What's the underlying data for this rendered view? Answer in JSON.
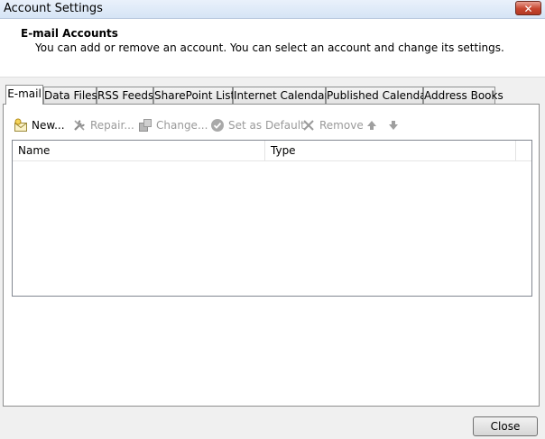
{
  "window": {
    "title": "Account Settings",
    "close_glyph": "✕"
  },
  "header": {
    "title": "E-mail Accounts",
    "description": "You can add or remove an account. You can select an account and change its settings."
  },
  "tabs": [
    {
      "label": "E-mail",
      "active": true
    },
    {
      "label": "Data Files"
    },
    {
      "label": "RSS Feeds"
    },
    {
      "label": "SharePoint Lists"
    },
    {
      "label": "Internet Calendars"
    },
    {
      "label": "Published Calendars"
    },
    {
      "label": "Address Books"
    }
  ],
  "toolbar": {
    "new_label": "New...",
    "repair_label": "Repair...",
    "change_label": "Change...",
    "set_default_label": "Set as Default",
    "remove_label": "Remove",
    "icons": [
      "new-account-icon",
      "repair-tools-icon",
      "change-icon",
      "checkmark-icon",
      "remove-x-icon",
      "arrow-up-icon",
      "arrow-down-icon"
    ]
  },
  "list": {
    "columns": [
      "Name",
      "Type"
    ],
    "rows": []
  },
  "footer": {
    "close_label": "Close"
  },
  "colors": {
    "title_bar": "#d6e4f5",
    "close_x": "#c7462f",
    "disabled_text": "#9a9a9a",
    "border": "#8e8f8f"
  }
}
